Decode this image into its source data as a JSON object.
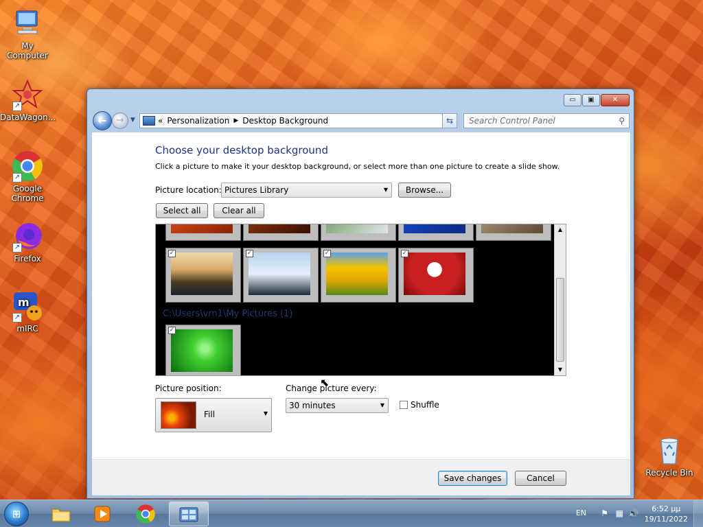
{
  "desktop": {
    "icons": [
      {
        "label": "My Computer",
        "icon": "computer-icon"
      },
      {
        "label": "DataWagon...",
        "icon": "datawagon-icon"
      },
      {
        "label": "Google Chrome",
        "icon": "chrome-icon"
      },
      {
        "label": "Firefox",
        "icon": "firefox-icon"
      },
      {
        "label": "mIRC",
        "icon": "mirc-icon"
      },
      {
        "label": "Recycle Bin",
        "icon": "recycle-bin-icon"
      }
    ]
  },
  "window": {
    "controls": {
      "minimize": "▭",
      "maximize": "▣",
      "close": "✕"
    },
    "breadcrumb": {
      "prefix": "«",
      "items": [
        "Personalization",
        "Desktop Background"
      ],
      "separator": "▶"
    },
    "search_placeholder": "Search Control Panel",
    "heading": "Choose your desktop background",
    "subtitle": "Click a picture to make it your desktop background, or select more than one picture to create a slide show.",
    "picture_location_label": "Picture location:",
    "picture_location_value": "Pictures Library",
    "browse_label": "Browse...",
    "select_all_label": "Select all",
    "clear_all_label": "Clear all",
    "gallery": {
      "folder_label": "C:\\Users\\vrn1\\My Pictures (1)",
      "top_row": [
        {
          "name": "flower-red",
          "colors": [
            "#e8501a",
            "#8a2406"
          ]
        },
        {
          "name": "desert",
          "colors": [
            "#9a3a10",
            "#3a1205"
          ]
        },
        {
          "name": "hydrangea",
          "colors": [
            "#5a8a3a",
            "#dfe6f0"
          ]
        },
        {
          "name": "jellyfish",
          "colors": [
            "#1a4fd8",
            "#0b2a80"
          ]
        },
        {
          "name": "koala",
          "colors": [
            "#b9a58a",
            "#5e4a33"
          ]
        }
      ],
      "middle_row": [
        {
          "name": "lighthouse",
          "checked": true,
          "colors": [
            "#f0d9a8",
            "#4a3a20"
          ]
        },
        {
          "name": "penguins",
          "checked": true,
          "colors": [
            "#b6d4ee",
            "#1b2a3a"
          ]
        },
        {
          "name": "tulips",
          "checked": true,
          "colors": [
            "#f2c300",
            "#5a8a1a"
          ]
        },
        {
          "name": "santa",
          "checked": true,
          "colors": [
            "#c82020",
            "#ffffff"
          ]
        }
      ],
      "bottom_row": [
        {
          "name": "windows-green",
          "checked": true,
          "colors": [
            "#3fd030",
            "#0c6a10"
          ]
        }
      ]
    },
    "picture_position_label": "Picture position:",
    "picture_position_value": "Fill",
    "change_picture_label": "Change picture every:",
    "change_picture_value": "30 minutes",
    "shuffle_label": "Shuffle",
    "save_label": "Save changes",
    "cancel_label": "Cancel"
  },
  "taskbar": {
    "language": "EN",
    "time": "6:52 μμ",
    "date": "19/11/2022"
  }
}
